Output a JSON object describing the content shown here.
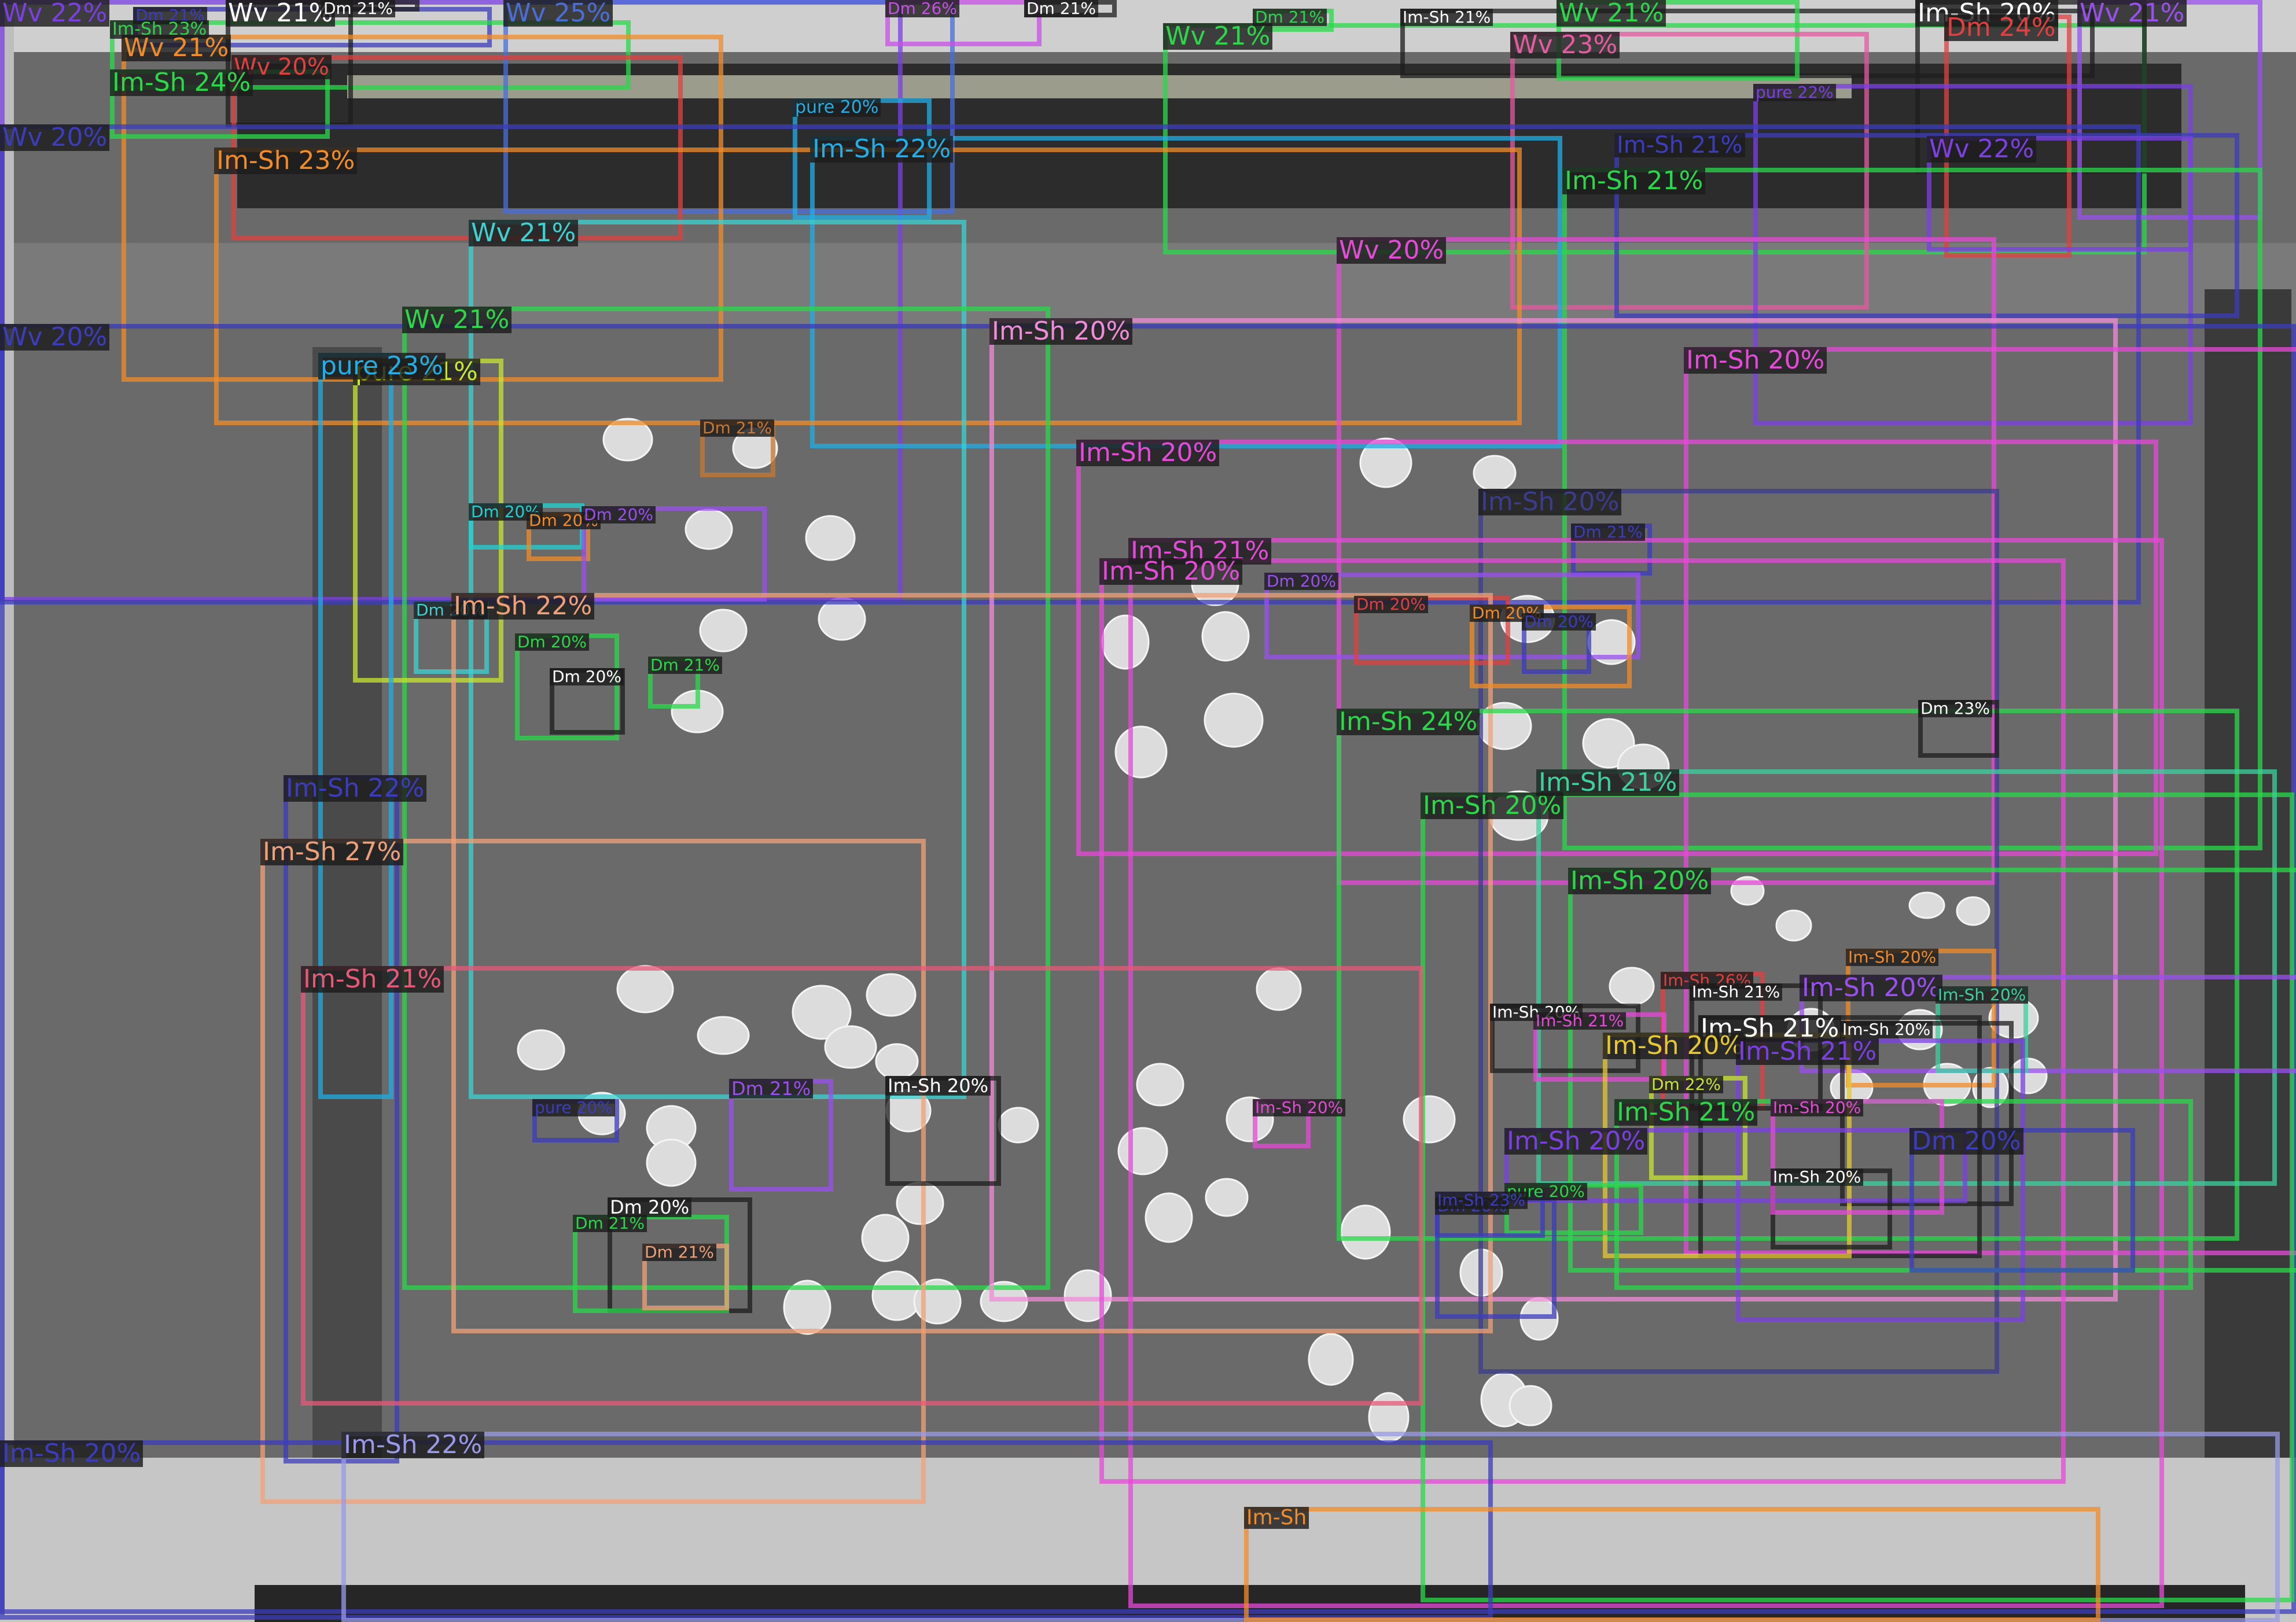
{
  "colors": {
    "tray_background": "#6a6a6a",
    "seed_fill": "#dcdcdc",
    "label_background": "#1c1c1c"
  },
  "legend_classes": [
    "Wv",
    "Im-Sh",
    "Dm",
    "pure"
  ],
  "detections": [
    {
      "label": "Wv 22%",
      "color": "#7b3fe4"
    },
    {
      "label": "Dm 21%",
      "color": "#3c3cbe"
    },
    {
      "label": "Im-Sh 23%",
      "color": "#2ad84a"
    },
    {
      "label": "Wv 21%",
      "color": "#1e1e1e"
    },
    {
      "label": "Dm 21%",
      "color": "#1e1e1e"
    },
    {
      "label": "Wv 25%",
      "color": "#4a6ed8"
    },
    {
      "label": "Dm 26%",
      "color": "#c850e6"
    },
    {
      "label": "Dm 21%",
      "color": "#1e1e1e"
    },
    {
      "label": "Wv 21%",
      "color": "#2ad84a"
    },
    {
      "label": "Dm 21%",
      "color": "#2ad84a"
    },
    {
      "label": "Im-Sh 21%",
      "color": "#1e1e1e"
    },
    {
      "label": "Wv 21%",
      "color": "#2ad84a"
    },
    {
      "label": "Im-Sh 20%",
      "color": "#1e1e1e"
    },
    {
      "label": "Dm 24%",
      "color": "#e24040"
    },
    {
      "label": "Wv 21%",
      "color": "#9a50f0"
    },
    {
      "label": "Wv 21%",
      "color": "#f28c28"
    },
    {
      "label": "Wv 20%",
      "color": "#e24040"
    },
    {
      "label": "Wv 23%",
      "color": "#e65aa0"
    },
    {
      "label": "Im-Sh 24%",
      "color": "#2ad84a"
    },
    {
      "label": "pure 20%",
      "color": "#22aee6"
    },
    {
      "label": "pure 22%",
      "color": "#7b3fe4"
    },
    {
      "label": "Wv 20%",
      "color": "#3c3cbe"
    },
    {
      "label": "Im-Sh 22%",
      "color": "#22aee6"
    },
    {
      "label": "Im-Sh 21%",
      "color": "#3c3cbe"
    },
    {
      "label": "Wv 22%",
      "color": "#7b3fe4"
    },
    {
      "label": "Im-Sh 23%",
      "color": "#f28c28"
    },
    {
      "label": "Im-Sh 21%",
      "color": "#2ad84a"
    },
    {
      "label": "Wv 21%",
      "color": "#3cd2d2"
    },
    {
      "label": "Wv 20%",
      "color": "#e64ad8"
    },
    {
      "label": "Wv 20%",
      "color": "#3c3cbe"
    },
    {
      "label": "Wv 21%",
      "color": "#2ad84a"
    },
    {
      "label": "Im-Sh 20%",
      "color": "#f08cd8"
    },
    {
      "label": "Im-Sh 20%",
      "color": "#e64ad8"
    },
    {
      "label": "Dm 21%",
      "color": "#c87832"
    },
    {
      "label": "pure 21%",
      "color": "#c8e632"
    },
    {
      "label": "pure 23%",
      "color": "#22aee6"
    },
    {
      "label": "Im-Sh 20%",
      "color": "#e64ad8"
    },
    {
      "label": "Im-Sh 20%",
      "color": "#3c3c8c"
    },
    {
      "label": "Dm 21%",
      "color": "#3c3cbe"
    },
    {
      "label": "Im-Sh 21%",
      "color": "#e64ad8"
    },
    {
      "label": "Im-Sh 20%",
      "color": "#e64ad8"
    },
    {
      "label": "Dm 20%",
      "color": "#22d2d2"
    },
    {
      "label": "Dm 20%",
      "color": "#f28c28"
    },
    {
      "label": "Dm 20%",
      "color": "#9a50f0"
    },
    {
      "label": "Dm 20%",
      "color": "#9a50f0"
    },
    {
      "label": "Dm 20%",
      "color": "#e24040"
    },
    {
      "label": "Dm 20%",
      "color": "#3cd2d2"
    },
    {
      "label": "Im-Sh 22%",
      "color": "#f0a078"
    },
    {
      "label": "Dm 20%",
      "color": "#f28c28"
    },
    {
      "label": "Dm 20%",
      "color": "#3c3cbe"
    },
    {
      "label": "Dm 20%",
      "color": "#2ad84a"
    },
    {
      "label": "Dm 21%",
      "color": "#2ad84a"
    },
    {
      "label": "Dm 20%",
      "color": "#1e1e1e"
    },
    {
      "label": "Im-Sh 24%",
      "color": "#2ad84a"
    },
    {
      "label": "Dm 23%",
      "color": "#1e1e1e"
    },
    {
      "label": "Im-Sh 20%",
      "color": "#2ad84a"
    },
    {
      "label": "Im-Sh 21%",
      "color": "#3cd2a0"
    },
    {
      "label": "Im-Sh 22%",
      "color": "#3c3cbe"
    },
    {
      "label": "Im-Sh 27%",
      "color": "#f0a078"
    },
    {
      "label": "Im-Sh 20%",
      "color": "#2ad84a"
    },
    {
      "label": "Im-Sh 20%",
      "color": "#9a50f0"
    },
    {
      "label": "Im-Sh 20%",
      "color": "#f28c28"
    },
    {
      "label": "Im-Sh 21%",
      "color": "#e65a78"
    },
    {
      "label": "Im-Sh 26%",
      "color": "#e24040"
    },
    {
      "label": "Im-Sh 21%",
      "color": "#1e1e1e"
    },
    {
      "label": "Im-Sh 20%",
      "color": "#3cd2a0"
    },
    {
      "label": "Im-Sh 20%",
      "color": "#1e1e1e"
    },
    {
      "label": "Im-Sh 21%",
      "color": "#e64ad8"
    },
    {
      "label": "Im-Sh 21%",
      "color": "#1e1e1e"
    },
    {
      "label": "Im-Sh 20%",
      "color": "#1e1e1e"
    },
    {
      "label": "Im-Sh 20%",
      "color": "#e6c832"
    },
    {
      "label": "Im-Sh 21%",
      "color": "#7b3fe4"
    },
    {
      "label": "pure 20%",
      "color": "#3c3cbe"
    },
    {
      "label": "Dm 21%",
      "color": "#9a50f0"
    },
    {
      "label": "Im-Sh 20%",
      "color": "#1e1e1e"
    },
    {
      "label": "Dm 22%",
      "color": "#c8e632"
    },
    {
      "label": "Im-Sh 20%",
      "color": "#e64ad8"
    },
    {
      "label": "Im-Sh 21%",
      "color": "#2ad84a"
    },
    {
      "label": "Im-Sh 20%",
      "color": "#7b3fe4"
    },
    {
      "label": "Im-Sh 20%",
      "color": "#1e1e1e"
    },
    {
      "label": "Im-Sh 20%",
      "color": "#e64ad8"
    },
    {
      "label": "Dm 20%",
      "color": "#3c3cbe"
    },
    {
      "label": "pure 20%",
      "color": "#2ad84a"
    },
    {
      "label": "Dm 20%",
      "color": "#1e1e1e"
    },
    {
      "label": "Dm 21%",
      "color": "#2ad84a"
    },
    {
      "label": "Dm 21%",
      "color": "#f0a078"
    },
    {
      "label": "Dm 20%",
      "color": "#3c3cbe"
    },
    {
      "label": "Im-Sh 23%",
      "color": "#3c3cbe"
    },
    {
      "label": "Im-Sh 20%",
      "color": "#3c3cbe"
    },
    {
      "label": "Im-Sh 22%",
      "color": "#9a9ae6"
    },
    {
      "label": "Im-Sh",
      "color": "#f28c28"
    }
  ]
}
